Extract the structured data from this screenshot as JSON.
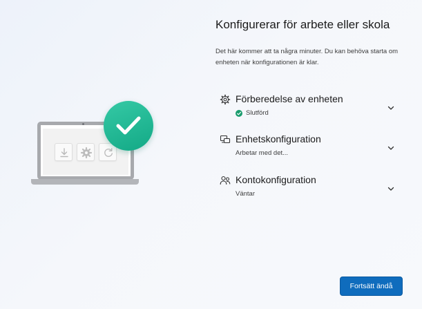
{
  "header": {
    "title": "Konfigurerar för arbete eller skola",
    "description": "Det här kommer att ta några minuter. Du kan behöva starta om enheten när konfigurationen är klar."
  },
  "steps": [
    {
      "title": "Förberedelse av enheten",
      "status": "Slutförd",
      "icon": "gear-icon",
      "state": "completed"
    },
    {
      "title": "Enhetskonfiguration",
      "status": "Arbetar med det...",
      "icon": "devices-icon",
      "state": "in-progress"
    },
    {
      "title": "Kontokonfiguration",
      "status": "Väntar",
      "icon": "people-icon",
      "state": "waiting"
    }
  ],
  "footer": {
    "continue_label": "Fortsätt ändå"
  },
  "colors": {
    "accent": "#0f6cbd",
    "success": "#1a9c6d",
    "badge": "#13a986"
  }
}
